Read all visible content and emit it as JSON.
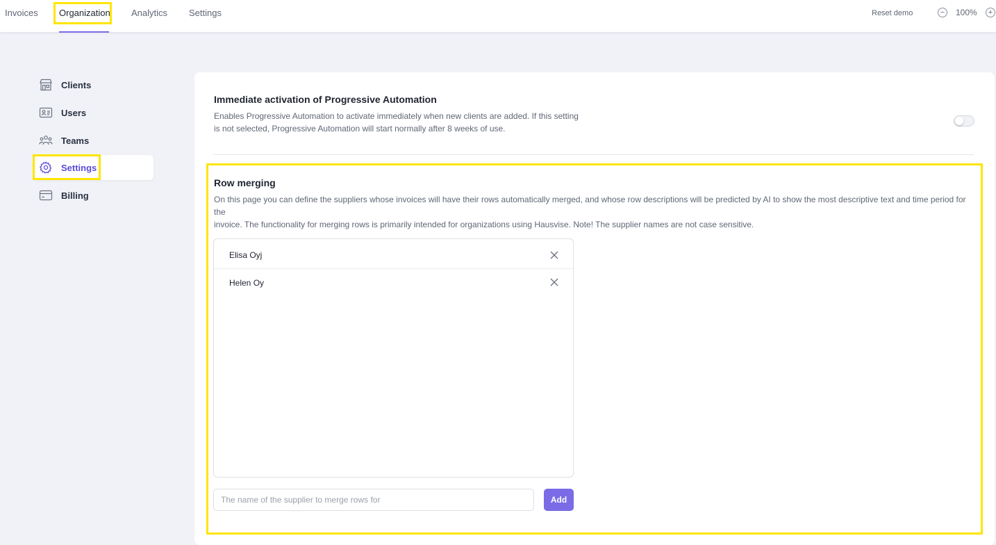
{
  "nav": {
    "items": [
      {
        "label": "Invoices"
      },
      {
        "label": "Organization"
      },
      {
        "label": "Analytics"
      },
      {
        "label": "Settings"
      }
    ],
    "active": "Organization",
    "reset_demo": "Reset demo",
    "zoom": "100%",
    "zoom_out_icon": "minus-circle-icon",
    "zoom_in_icon": "plus-circle-icon"
  },
  "sidebar": {
    "items": [
      {
        "label": "Clients",
        "icon": "storefront-icon"
      },
      {
        "label": "Users",
        "icon": "id-card-icon"
      },
      {
        "label": "Teams",
        "icon": "people-group-icon"
      },
      {
        "label": "Settings",
        "icon": "gear-icon"
      },
      {
        "label": "Billing",
        "icon": "credit-card-icon"
      }
    ],
    "active": "Settings"
  },
  "progressive_automation": {
    "title": "Immediate activation of Progressive Automation",
    "description_line1": "Enables Progressive Automation to activate immediately when new clients are added. If this setting",
    "description_line2": "is not selected, Progressive Automation will start normally after 8 weeks of use.",
    "enabled": false
  },
  "row_merging": {
    "title": "Row merging",
    "description_line1": "On this page you can define the suppliers whose invoices will have their rows automatically merged, and whose row descriptions will be predicted by AI to show the most descriptive text and time period for the",
    "description_line2": "invoice. The functionality for merging rows is primarily intended for organizations using Hausvise. Note! The supplier names are not case sensitive.",
    "suppliers": [
      {
        "name": "Elisa Oyj"
      },
      {
        "name": "Helen Oy"
      }
    ],
    "input_placeholder": "The name of the supplier to merge rows for",
    "input_value": "",
    "add_label": "Add"
  },
  "colors": {
    "accent": "#7b6be6",
    "highlight": "#ffe500",
    "background": "#f0f2f7"
  }
}
